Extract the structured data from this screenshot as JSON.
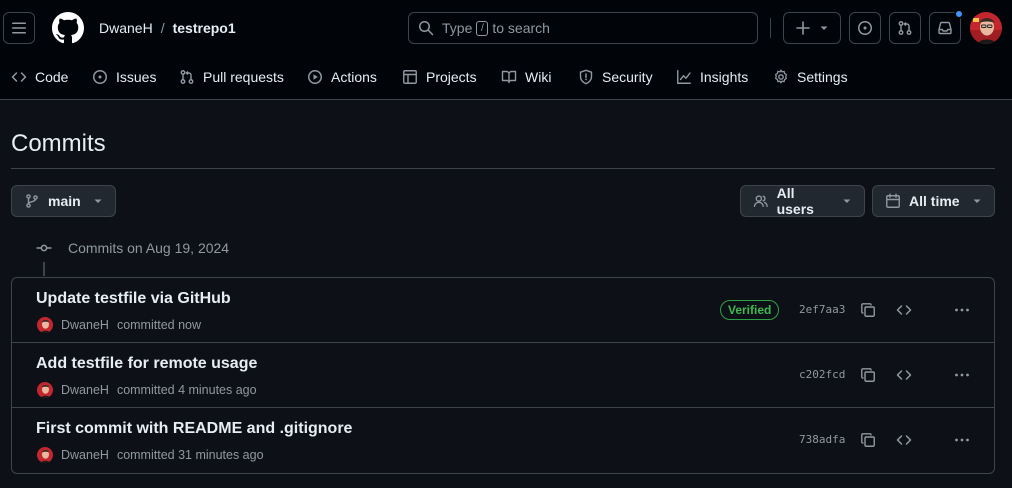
{
  "header": {
    "owner": "DwaneH",
    "separator": "/",
    "repo": "testrepo1",
    "search_prefix": "Type",
    "search_key": "/",
    "search_suffix": "to search"
  },
  "repo_nav": [
    {
      "label": "Code",
      "icon": "code-icon"
    },
    {
      "label": "Issues",
      "icon": "issue-icon"
    },
    {
      "label": "Pull requests",
      "icon": "pull-request-icon"
    },
    {
      "label": "Actions",
      "icon": "play-icon"
    },
    {
      "label": "Projects",
      "icon": "table-icon"
    },
    {
      "label": "Wiki",
      "icon": "book-icon"
    },
    {
      "label": "Security",
      "icon": "shield-icon"
    },
    {
      "label": "Insights",
      "icon": "graph-icon"
    },
    {
      "label": "Settings",
      "icon": "gear-icon"
    }
  ],
  "page": {
    "title": "Commits",
    "branch": "main",
    "users_filter": "All users",
    "time_filter": "All time"
  },
  "commit_group": {
    "heading": "Commits on Aug 19, 2024",
    "commits": [
      {
        "message": "Update testfile via GitHub",
        "author": "DwaneH",
        "meta": "committed now",
        "verified": "Verified",
        "sha": "2ef7aa3"
      },
      {
        "message": "Add testfile for remote usage",
        "author": "DwaneH",
        "meta": "committed 4 minutes ago",
        "verified": "",
        "sha": "c202fcd"
      },
      {
        "message": "First commit with README and .gitignore",
        "author": "DwaneH",
        "meta": "committed 31 minutes ago",
        "verified": "",
        "sha": "738adfa"
      }
    ]
  },
  "colors": {
    "background": "#0d1117",
    "header_bg": "#010409",
    "border": "#3d444d",
    "verified_green": "#3fb950",
    "notification_blue": "#4493f8"
  }
}
